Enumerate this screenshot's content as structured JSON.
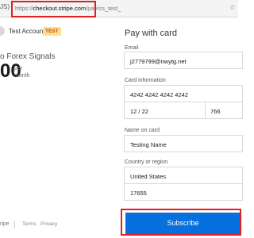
{
  "browser": {
    "left_fragment": "JS)",
    "url_prefix": "https://",
    "url_host": "checkout.stripe.com",
    "url_path": "/pay/cs_test_",
    "right_fragment": "☆"
  },
  "account": {
    "name": "Test Account",
    "badge": "TEST"
  },
  "product": {
    "name": "o Forex Signals",
    "price": "00",
    "period_line1": "per",
    "period_line2": "month"
  },
  "footer": {
    "brand": "ripe",
    "terms": "Terms",
    "privacy": "Privacy"
  },
  "form": {
    "title": "Pay with card",
    "email_label": "Email",
    "email_value": "j2779799@nwytg.net",
    "card_label": "Card information",
    "card_number": "4242 4242 4242 4242",
    "card_expiry": "12 / 22",
    "card_cvc": "766",
    "name_label": "Name on card",
    "name_value": "Testing Name",
    "region_label": "Country or region",
    "country": "United States",
    "zip": "17655",
    "submit_label": "Subscribe"
  },
  "colors": {
    "highlight": "#e0201f",
    "button": "#0570de",
    "badge_bg": "#ffde92",
    "badge_text": "#bb5504"
  }
}
